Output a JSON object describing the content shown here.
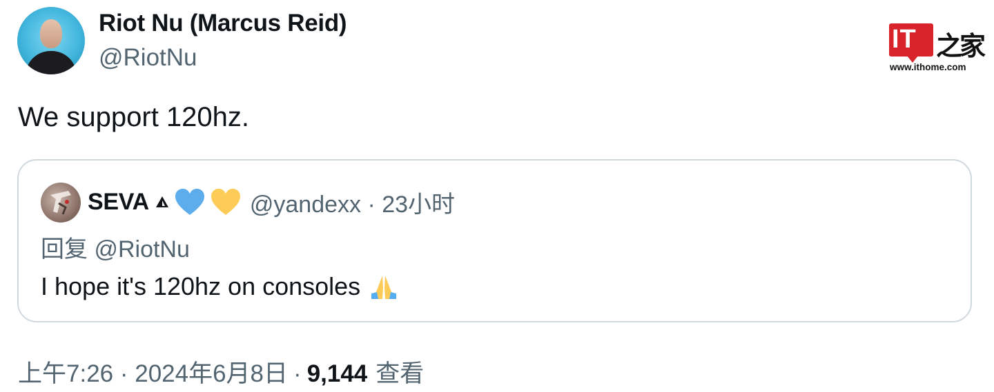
{
  "author": {
    "display_name": "Riot Nu (Marcus Reid)",
    "handle": "@RiotNu"
  },
  "watermark": {
    "logo_text": "IT之家",
    "url": "www.ithome.com",
    "brand_color": "#d9232a"
  },
  "tweet": {
    "text": "We support 120hz."
  },
  "quoted_tweet": {
    "display_name": "SEVA",
    "name_icons": [
      "triangle-icon",
      "blue-heart-icon",
      "yellow-heart-icon"
    ],
    "handle_time": "@yandexx · 23小时",
    "reply_to": "回复 @RiotNu",
    "text": "I hope it's 120hz on consoles",
    "emoji": "praying-hands-icon"
  },
  "meta": {
    "time_date": "上午7:26 · 2024年6月8日",
    "separator": "·",
    "views_count": "9,144",
    "views_label": "查看"
  },
  "colors": {
    "text_primary": "#0f1419",
    "text_secondary": "#536471",
    "border": "#cfd9de"
  }
}
